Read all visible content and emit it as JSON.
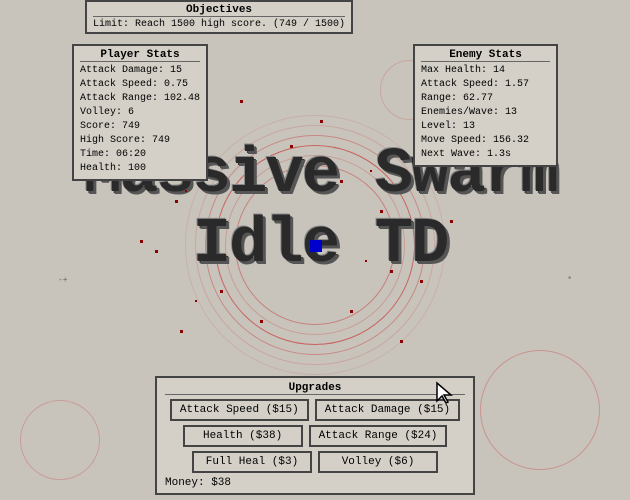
{
  "objectives": {
    "title": "Objectives",
    "limit_text": "Limit: Reach 1500 high score. (749 / 1500)"
  },
  "player_stats": {
    "title": "Player Stats",
    "stats": [
      {
        "label": "Attack Damage: 15"
      },
      {
        "label": "Attack Speed: 0.75"
      },
      {
        "label": "Attack Range: 102.48"
      },
      {
        "label": "Volley: 6"
      },
      {
        "label": "Score: 749"
      },
      {
        "label": "High Score: 749"
      },
      {
        "label": "Time: 06:20"
      },
      {
        "label": "Health: 100"
      }
    ]
  },
  "enemy_stats": {
    "title": "Enemy Stats",
    "stats": [
      {
        "label": "Max Health: 14"
      },
      {
        "label": "Attack Speed: 1.57"
      },
      {
        "label": "Range: 62.77"
      },
      {
        "label": "Enemies/Wave: 13"
      },
      {
        "label": "Level: 13"
      },
      {
        "label": "Move Speed: 156.32"
      },
      {
        "label": "Next Wave: 1.3s"
      }
    ]
  },
  "game_title": {
    "line1": "Massive Swarm",
    "line2": "Idle TD"
  },
  "upgrades": {
    "title": "Upgrades",
    "buttons": [
      {
        "label": "Attack Speed ($15)",
        "row": 0
      },
      {
        "label": "Attack Damage ($15)",
        "row": 0
      },
      {
        "label": "Health ($38)",
        "row": 1
      },
      {
        "label": "Attack Range ($24)",
        "row": 1
      },
      {
        "label": "Full Heal ($3)",
        "row": 2
      },
      {
        "label": "Volley ($6)",
        "row": 2
      }
    ],
    "money_label": "Money: $38"
  },
  "colors": {
    "background": "#c8c4bc",
    "border": "#444444",
    "panel_bg": "#d4d0c8",
    "player": "#0000cc",
    "enemy": "#8b0000"
  }
}
